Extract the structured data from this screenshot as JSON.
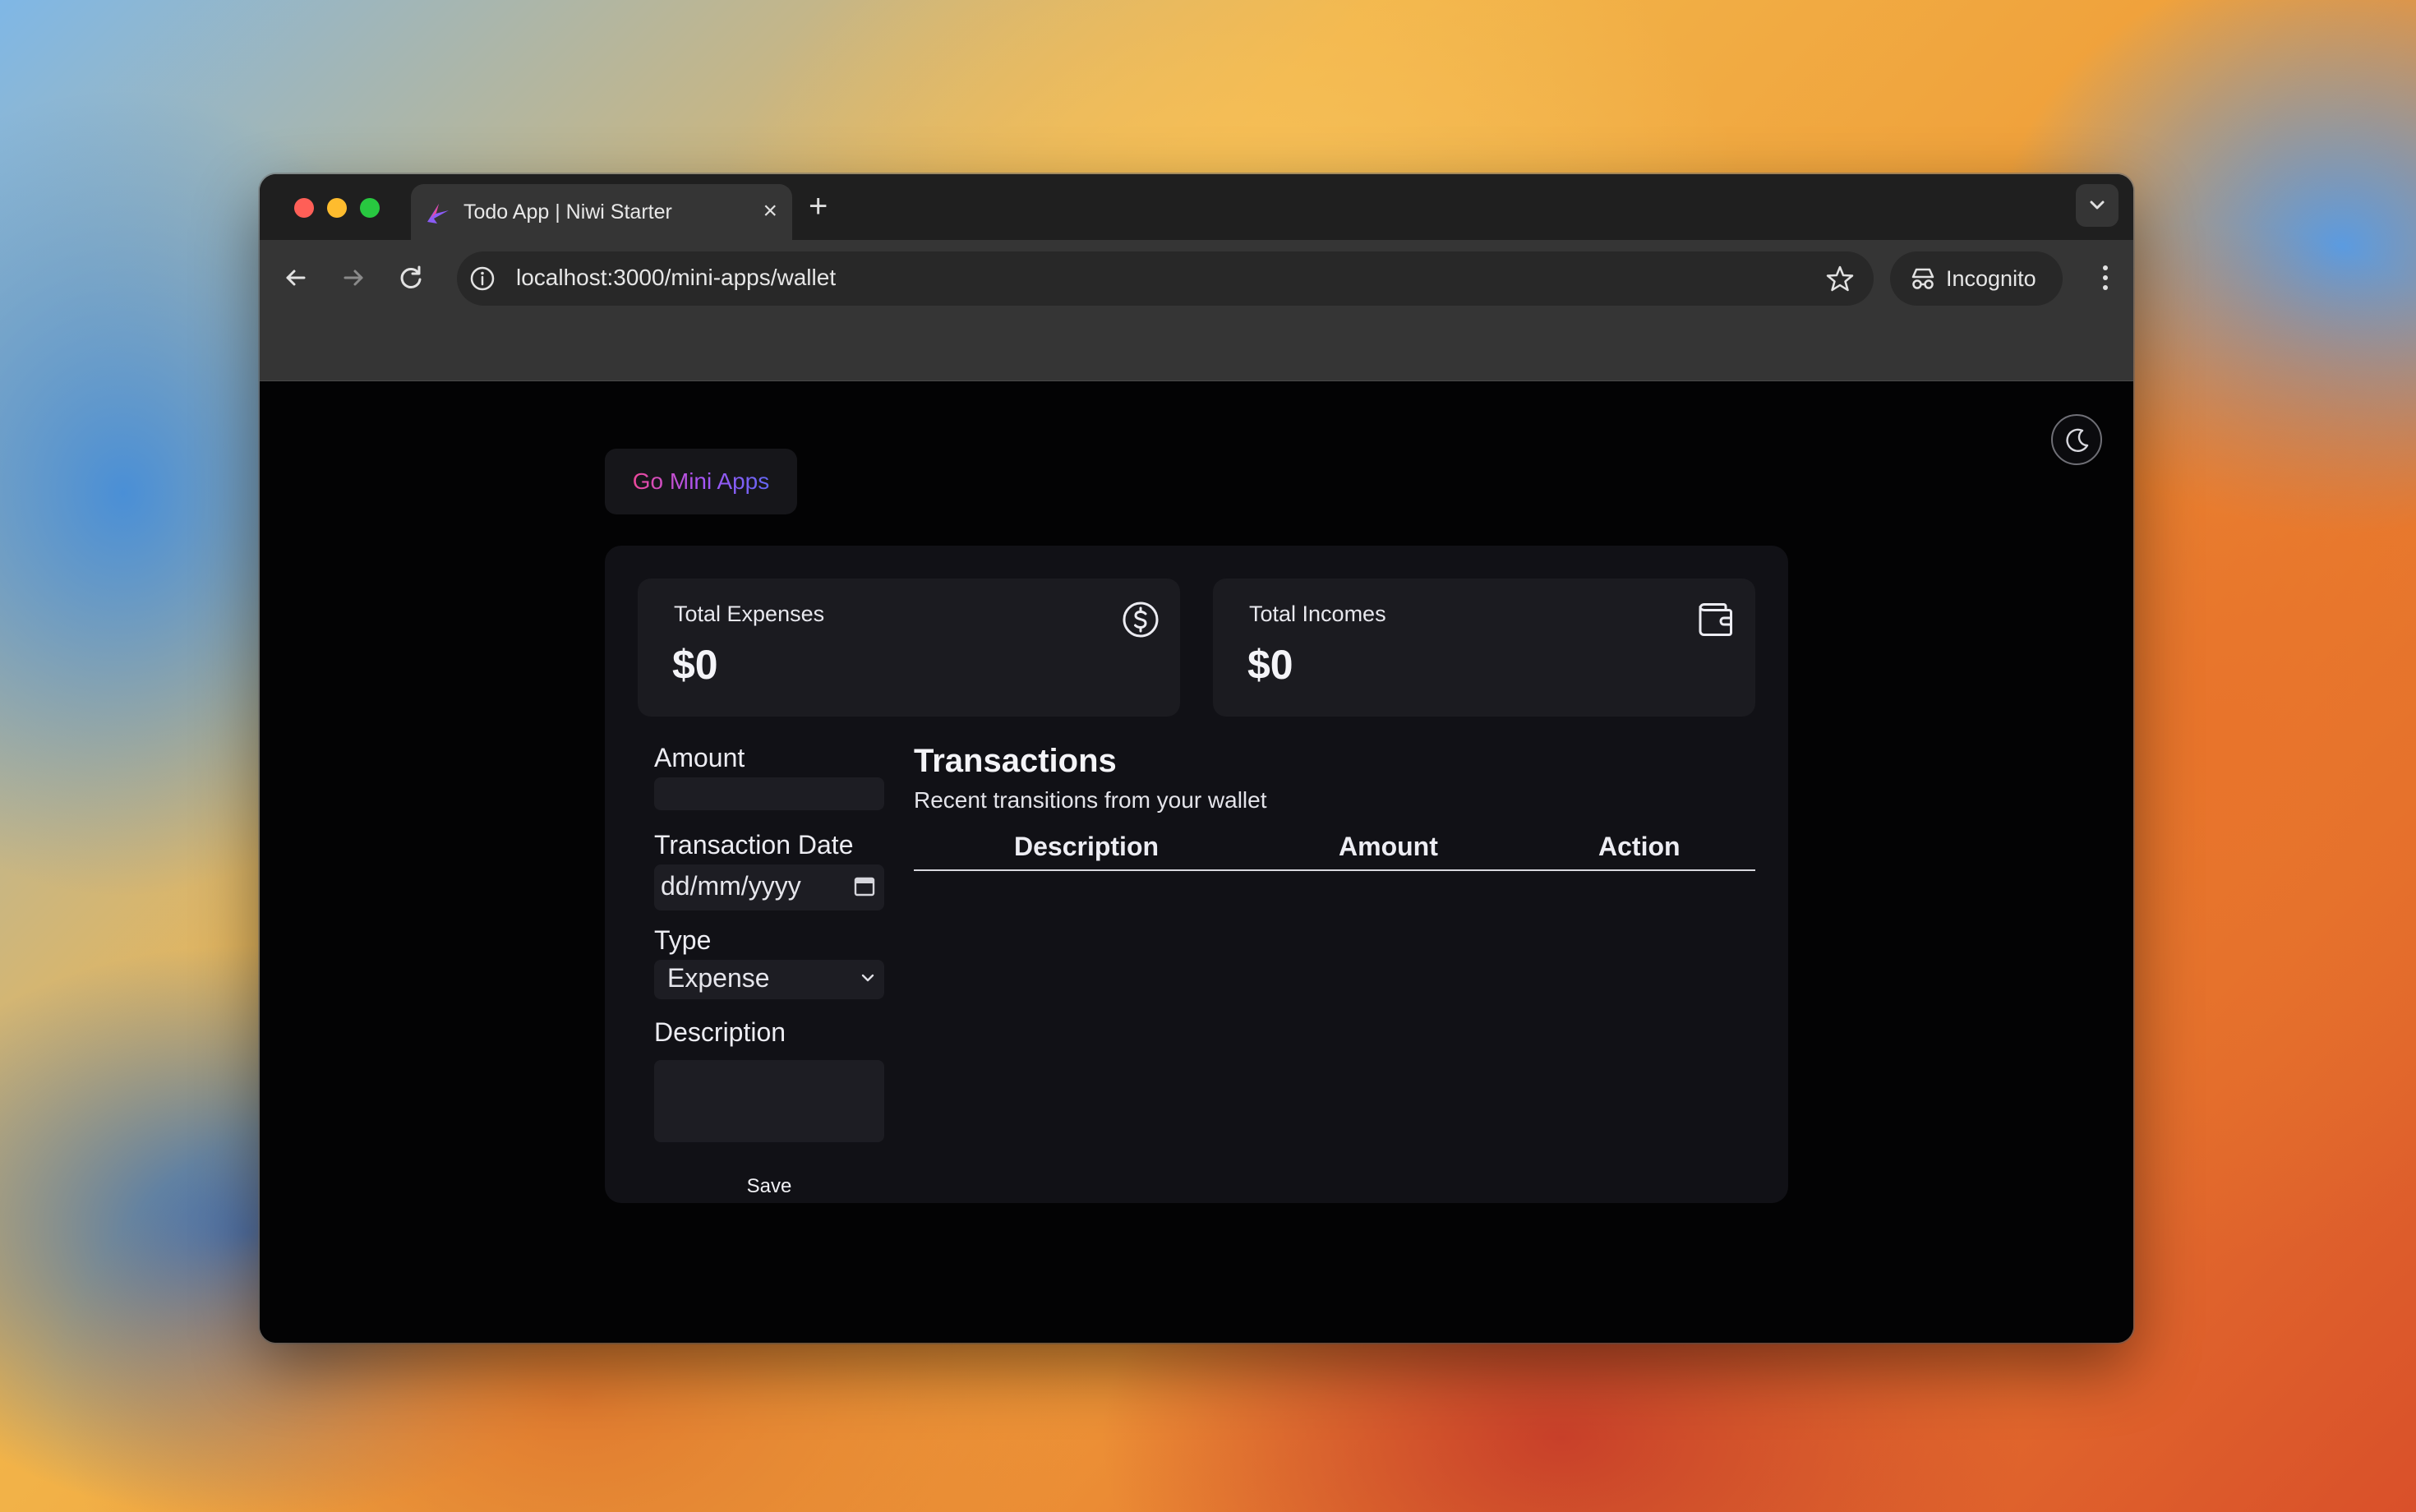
{
  "browser": {
    "tab_title": "Todo App | Niwi Starter",
    "tab_close": "×",
    "new_tab": "+",
    "url": "localhost:3000/mini-apps/wallet",
    "incognito_label": "Incognito"
  },
  "page": {
    "go_button": "Go Mini Apps",
    "cards": {
      "expenses": {
        "label": "Total Expenses",
        "value": "$0",
        "icon": "dollar-circle-icon"
      },
      "incomes": {
        "label": "Total Incomes",
        "value": "$0",
        "icon": "wallet-icon"
      }
    },
    "form": {
      "amount_label": "Amount",
      "amount_value": "",
      "date_label": "Transaction Date",
      "date_placeholder": "dd/mm/yyyy",
      "type_label": "Type",
      "type_value": "Expense",
      "description_label": "Description",
      "description_value": "",
      "save_label": "Save"
    },
    "transactions": {
      "title": "Transactions",
      "subtitle": "Recent transitions from your wallet",
      "columns": [
        "Description",
        "Amount",
        "Action"
      ],
      "rows": []
    }
  },
  "colors": {
    "page_bg": "#030304",
    "panel_bg": "#111116",
    "card_bg": "#1b1b20",
    "go_gradient_start": "#ec4899",
    "go_gradient_end": "#6366f1"
  }
}
